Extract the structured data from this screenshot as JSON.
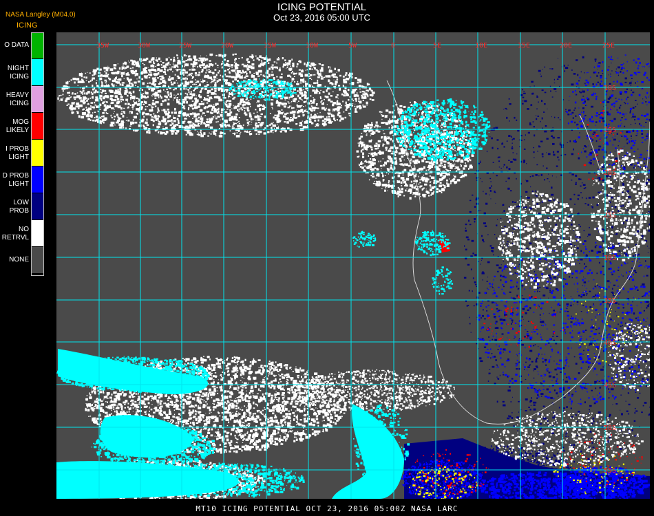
{
  "header": {
    "brand": "NASA Langley (M04.0)",
    "title": "ICING POTENTIAL",
    "subtitle": "Oct 23, 2016 05:00 UTC",
    "legend_title": "ICING"
  },
  "legend": [
    {
      "line1": "O DATA",
      "line2": "",
      "color": "#00b400"
    },
    {
      "line1": "NIGHT",
      "line2": "ICING",
      "color": "#00ffff"
    },
    {
      "line1": "HEAVY",
      "line2": "ICING",
      "color": "#e0a0e0"
    },
    {
      "line1": "MOG",
      "line2": "LIKELY",
      "color": "#ff0000"
    },
    {
      "line1": "I PROB",
      "line2": "LIGHT",
      "color": "#ffff00"
    },
    {
      "line1": "D PROB",
      "line2": "LIGHT",
      "color": "#0000ff"
    },
    {
      "line1": "LOW",
      "line2": "PROB",
      "color": "#000080"
    },
    {
      "line1": "NO",
      "line2": "RETRVL",
      "color": "#ffffff"
    },
    {
      "line1": "NONE",
      "line2": "",
      "color": "#4a4a4a"
    }
  ],
  "map": {
    "lon_labels": [
      "35W",
      "30W",
      "25W",
      "20W",
      "15W",
      "10W",
      "5W",
      "0",
      "5E",
      "10E",
      "15E",
      "20E",
      "25E",
      "30E"
    ],
    "lat_labels": [
      "10S",
      "15S",
      "20S",
      "25S",
      "30S",
      "35S",
      "40S",
      "45S",
      "50S",
      "55S"
    ],
    "colors": {
      "background": "#4a4a4a",
      "grid": "#00e5ee",
      "grid_label": "#ff2a2a",
      "coast": "#d8d8d8",
      "cloud_white": "#ffffff",
      "cloud_cyan": "#00ffff",
      "low_prob": "#000080",
      "prob_light": "#0000ff",
      "mog": "#ff0000",
      "light": "#ffff00"
    }
  },
  "footer": {
    "text": "MT10  ICING POTENTIAL   OCT 23, 2016 05:00Z   NASA LARC"
  }
}
